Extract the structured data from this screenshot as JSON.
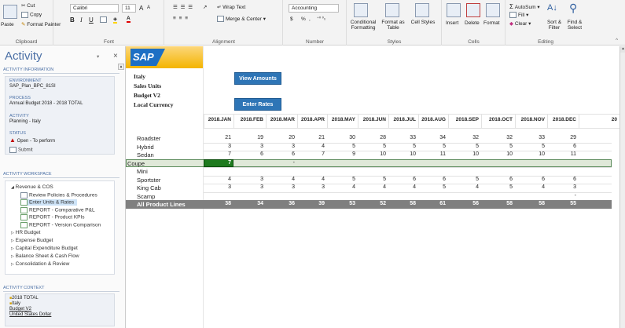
{
  "ribbon": {
    "clipboard": {
      "paste": "Paste",
      "cut": "Cut",
      "copy": "Copy",
      "format_painter": "Format Painter",
      "label": "Clipboard"
    },
    "font": {
      "name": "Calibri",
      "size": "11",
      "bold": "B",
      "italic": "I",
      "underline": "U",
      "label": "Font",
      "grow": "A",
      "shrink": "A"
    },
    "alignment": {
      "wrap_text": "Wrap Text",
      "merge_center": "Merge & Center",
      "label": "Alignment"
    },
    "number": {
      "format": "Accounting",
      "currency": "$",
      "percent": "%",
      "comma": ",",
      "label": "Number"
    },
    "styles": {
      "conditional": "Conditional Formatting",
      "format_table": "Format as Table",
      "cell_styles": "Cell Styles",
      "label": "Styles"
    },
    "cells": {
      "insert": "Insert",
      "delete": "Delete",
      "format": "Format",
      "label": "Cells"
    },
    "editing": {
      "autosum": "AutoSum",
      "fill": "Fill",
      "clear": "Clear",
      "sort": "Sort & Filter",
      "find": "Find & Select",
      "label": "Editing"
    }
  },
  "panel": {
    "title": "Activity",
    "info_header": "ACTIVITY INFORMATION",
    "env_label": "ENVIRONMENT",
    "env_value": "SAP_Plan_BPC_81SI",
    "process_label": "PROCESS",
    "process_value": "Annual Budget 2018 - 2018 TOTAL",
    "activity_label": "ACTIVITY",
    "activity_value": "Planning - Italy",
    "status_label": "STATUS",
    "status_value": "Open - To perform",
    "submit": "Submit",
    "workspace_header": "ACTIVITY WORKSPACE",
    "tree": {
      "revenue": "Revenue & COS",
      "review": "Review Policies & Procedures",
      "enter_units": "Enter Units & Rates",
      "comparative": "REPORT - Comparative P&L",
      "kpis": "REPORT - Product KPIs",
      "version": "REPORT - Version Comparison",
      "hr": "HR Budget",
      "expense": "Expense Budget",
      "capex": "Capital Expenditure Budget",
      "balance": "Balance Sheet & Cash Flow",
      "consolidation": "Consolidation & Review"
    },
    "context_header": "ACTIVITY CONTEXT",
    "context": [
      "2018 TOTAL",
      "Italy",
      "Budget V2",
      "United States Dollar"
    ]
  },
  "sheet": {
    "logo": "SAP",
    "info": [
      "Italy",
      "Sales Units",
      "Budget V2",
      "Local Currency"
    ],
    "view_amounts": "View Amounts",
    "enter_rates": "Enter Rates",
    "months": [
      "2018.JAN",
      "2018.FEB",
      "2018.MAR",
      "2018.APR",
      "2018.MAY",
      "2018.JUN",
      "2018.JUL",
      "2018.AUG",
      "2018.SEP",
      "2018.OCT",
      "2018.NOV",
      "2018.DEC",
      "20"
    ],
    "rows": [
      {
        "label": "Roadster",
        "values": [
          "21",
          "19",
          "20",
          "21",
          "30",
          "28",
          "33",
          "34",
          "32",
          "32",
          "33",
          "29"
        ]
      },
      {
        "label": "Hybrid",
        "values": [
          "3",
          "3",
          "3",
          "4",
          "5",
          "5",
          "5",
          "5",
          "5",
          "5",
          "5",
          "6"
        ]
      },
      {
        "label": "Sedan",
        "values": [
          "7",
          "6",
          "6",
          "7",
          "9",
          "10",
          "10",
          "11",
          "10",
          "10",
          "10",
          "11"
        ]
      },
      {
        "label": "Coupe",
        "values": [
          "7",
          "",
          "-",
          "",
          "",
          "",
          "",
          "",
          "",
          "",
          "",
          ""
        ]
      },
      {
        "label": "Mini",
        "values": [
          "",
          "",
          "",
          "",
          "",
          "",
          "",
          "",
          "",
          "",
          "",
          ""
        ]
      },
      {
        "label": "Sportster",
        "values": [
          "4",
          "3",
          "4",
          "4",
          "5",
          "5",
          "6",
          "6",
          "5",
          "6",
          "6",
          "6"
        ]
      },
      {
        "label": "King Cab",
        "values": [
          "3",
          "3",
          "3",
          "3",
          "4",
          "4",
          "4",
          "5",
          "4",
          "5",
          "4",
          "3"
        ]
      },
      {
        "label": "Scamp",
        "values": [
          "",
          "",
          "",
          "",
          "",
          "",
          "",
          "",
          "",
          "",
          "",
          "-"
        ]
      },
      {
        "label": "All Product Lines",
        "values": [
          "38",
          "34",
          "36",
          "39",
          "53",
          "52",
          "58",
          "61",
          "56",
          "58",
          "58",
          "55"
        ]
      }
    ]
  },
  "colors": {
    "accent": "#4a6fa5",
    "button": "#2e75b6",
    "total_row": "#7f7f7f",
    "selected": "#1e7a1e",
    "coupe_row": "#dfe8d8",
    "status_icon": "#c00000"
  }
}
